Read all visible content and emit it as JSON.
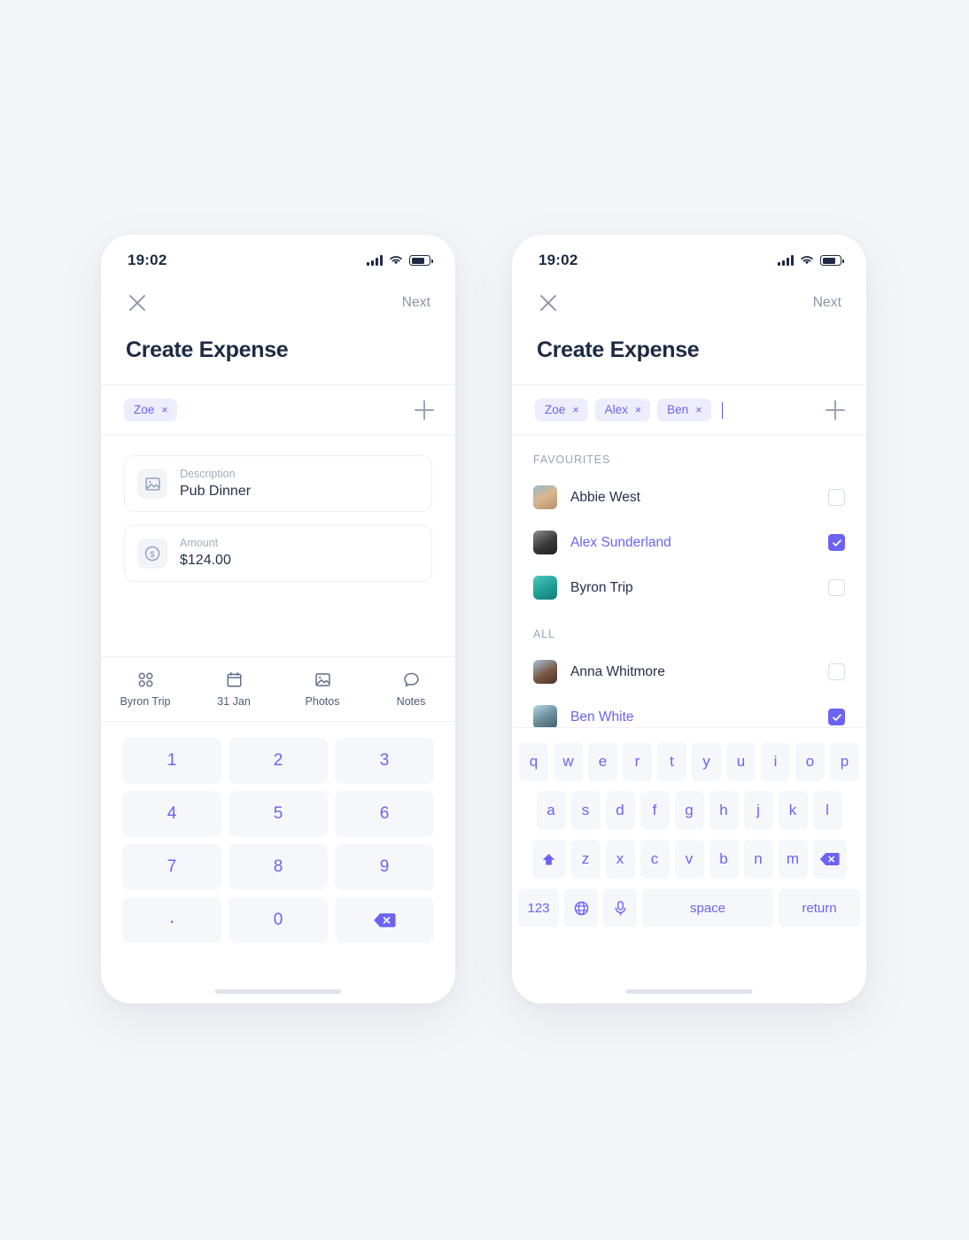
{
  "statusbar": {
    "time": "19:02",
    "signal_icon": "signal-bars-icon",
    "wifi_icon": "wifi-icon",
    "battery_icon": "battery-icon"
  },
  "nav": {
    "close_icon": "close-icon",
    "next_label": "Next"
  },
  "screen": {
    "title": "Create Expense"
  },
  "left": {
    "chips": [
      {
        "name": "Zoe",
        "remove": "×"
      }
    ],
    "add_icon": "plus-icon",
    "fields": [
      {
        "icon": "image-icon",
        "label": "Description",
        "value": "Pub Dinner"
      },
      {
        "icon": "dollar-coin-icon",
        "label": "Amount",
        "value": "$124.00"
      }
    ],
    "tabs": [
      {
        "icon": "grid-dots-icon",
        "label": "Byron Trip"
      },
      {
        "icon": "calendar-icon",
        "label": "31 Jan"
      },
      {
        "icon": "photo-icon",
        "label": "Photos"
      },
      {
        "icon": "chat-bubble-icon",
        "label": "Notes"
      }
    ],
    "numpad": [
      {
        "label": "1",
        "name": "num-1"
      },
      {
        "label": "2",
        "name": "num-2"
      },
      {
        "label": "3",
        "name": "num-3"
      },
      {
        "label": "4",
        "name": "num-4"
      },
      {
        "label": "5",
        "name": "num-5"
      },
      {
        "label": "6",
        "name": "num-6"
      },
      {
        "label": "7",
        "name": "num-7"
      },
      {
        "label": "8",
        "name": "num-8"
      },
      {
        "label": "9",
        "name": "num-9"
      },
      {
        "label": ".",
        "name": "num-decimal"
      },
      {
        "label": "0",
        "name": "num-0"
      },
      {
        "label": "",
        "name": "backspace"
      }
    ]
  },
  "right": {
    "chips": [
      {
        "name": "Zoe",
        "remove": "×"
      },
      {
        "name": "Alex",
        "remove": "×"
      },
      {
        "name": "Ben",
        "remove": "×"
      }
    ],
    "add_icon": "plus-icon",
    "sections": [
      {
        "title": "FAVOURITES",
        "contacts": [
          {
            "name": "Abbie West",
            "selected": false,
            "avatar": "abbie-west-avatar",
            "avatar_colors": [
              "#c9a98a",
              "#6fa8c8"
            ]
          },
          {
            "name": "Alex Sunderland",
            "selected": true,
            "avatar": "alex-sunderland-avatar",
            "avatar_colors": [
              "#5a5a5a",
              "#2c2c2c"
            ]
          },
          {
            "name": "Byron Trip",
            "selected": false,
            "avatar": "byron-trip-avatar",
            "avatar_colors": [
              "#2fb3a8",
              "#1d8f86"
            ]
          }
        ]
      },
      {
        "title": "ALL",
        "contacts": [
          {
            "name": "Anna Whitmore",
            "selected": false,
            "avatar": "anna-whitmore-avatar",
            "avatar_colors": [
              "#8aa9c4",
              "#6b4f3f"
            ]
          },
          {
            "name": "Ben White",
            "selected": true,
            "avatar": "ben-white-avatar",
            "avatar_colors": [
              "#9ec4d8",
              "#5c7f8c"
            ]
          },
          {
            "name": "",
            "selected": false,
            "avatar": "partial-avatar",
            "avatar_colors": [
              "#2fb3a8",
              "#1d8f86"
            ]
          }
        ]
      }
    ],
    "keyboard": {
      "row1": [
        "q",
        "w",
        "e",
        "r",
        "t",
        "y",
        "u",
        "i",
        "o",
        "p"
      ],
      "row2": [
        "a",
        "s",
        "d",
        "f",
        "g",
        "h",
        "j",
        "k",
        "l"
      ],
      "row3": [
        "z",
        "x",
        "c",
        "v",
        "b",
        "n",
        "m"
      ],
      "shift_icon": "shift-icon",
      "backspace_icon": "backspace-icon",
      "numbers_label": "123",
      "globe_icon": "globe-icon",
      "mic_icon": "microphone-icon",
      "space_label": "space",
      "return_label": "return"
    }
  },
  "colors": {
    "accent": "#6c63f5",
    "chip_bg": "#eeedfd",
    "title": "#1e2a44",
    "muted": "#8a93a8",
    "key_bg": "#f6f7fa",
    "page_bg": "#f4f5f8"
  }
}
